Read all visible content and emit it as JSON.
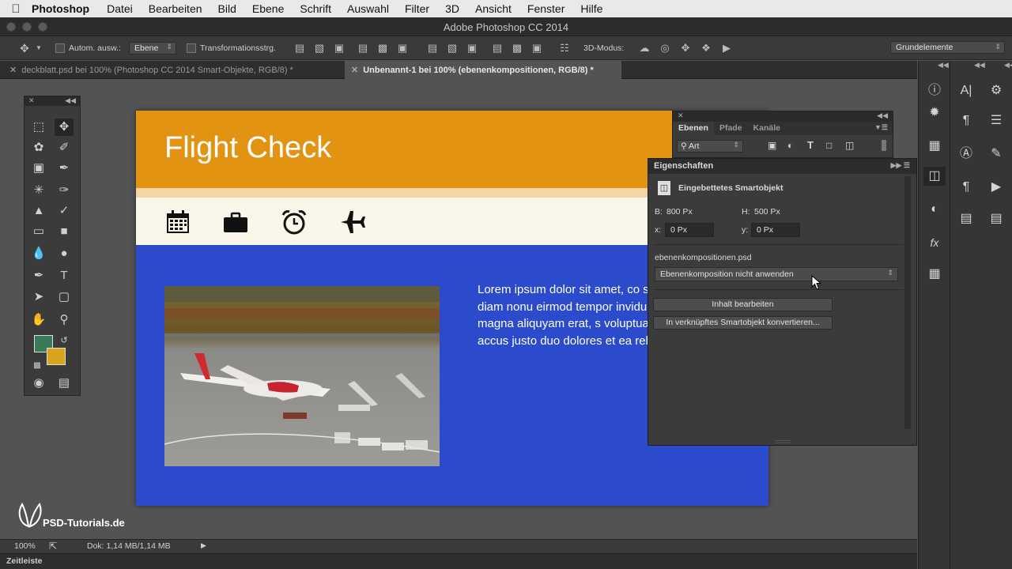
{
  "menubar": {
    "app": "Photoshop",
    "items": [
      "Datei",
      "Bearbeiten",
      "Bild",
      "Ebene",
      "Schrift",
      "Auswahl",
      "Filter",
      "3D",
      "Ansicht",
      "Fenster",
      "Hilfe"
    ]
  },
  "window": {
    "title": "Adobe Photoshop CC 2014"
  },
  "options": {
    "auto_select_label": "Autom. ausw.:",
    "auto_select_value": "Ebene",
    "transform_label": "Transformationsstrg.",
    "mode3d_label": "3D-Modus:",
    "workspace": "Grundelemente"
  },
  "tabs": [
    {
      "label": "deckblatt.psd bei 100% (Photoshop CC 2014  Smart-Objekte, RGB/8) *"
    },
    {
      "label": "Unbenannt-1 bei 100% (ebenenkompositionen, RGB/8) *"
    }
  ],
  "canvas": {
    "title": "Flight Check",
    "lorem": "Lorem ipsum dolor sit amet, co sadipscing elitr, sed diam nonu eirmod tempor invidunt ut labo dolore magna aliquyam erat, s voluptua. At vero eos et accus justo duo dolores et ea rebum.",
    "colors": {
      "banner": "#e29312",
      "body": "#2b4bcc",
      "iconbar": "#fbf6ea"
    },
    "icons": [
      "calendar-icon",
      "briefcase-icon",
      "alarm-clock-icon",
      "airplane-icon"
    ]
  },
  "layers": {
    "tabs": [
      "Ebenen",
      "Pfade",
      "Kanäle"
    ],
    "filter_value": "Art"
  },
  "properties": {
    "title": "Eigenschaften",
    "object_type": "Eingebettetes Smartobjekt",
    "w_label": "B:",
    "w_value": "800 Px",
    "h_label": "H:",
    "h_value": "500 Px",
    "x_label": "x:",
    "x_value": "0 Px",
    "y_label": "y:",
    "y_value": "0 Px",
    "file": "ebenenkompositionen.psd",
    "comp_select": "Ebenenkomposition nicht anwenden",
    "edit_button": "Inhalt bearbeiten",
    "convert_button": "In verknüpftes Smartobjekt konvertieren..."
  },
  "status": {
    "zoom": "100%",
    "doc": "Dok: 1,14 MB/1,14 MB"
  },
  "timeline": {
    "label": "Zeitleiste"
  },
  "watermark": {
    "text": "PSD-Tutorials.de"
  }
}
